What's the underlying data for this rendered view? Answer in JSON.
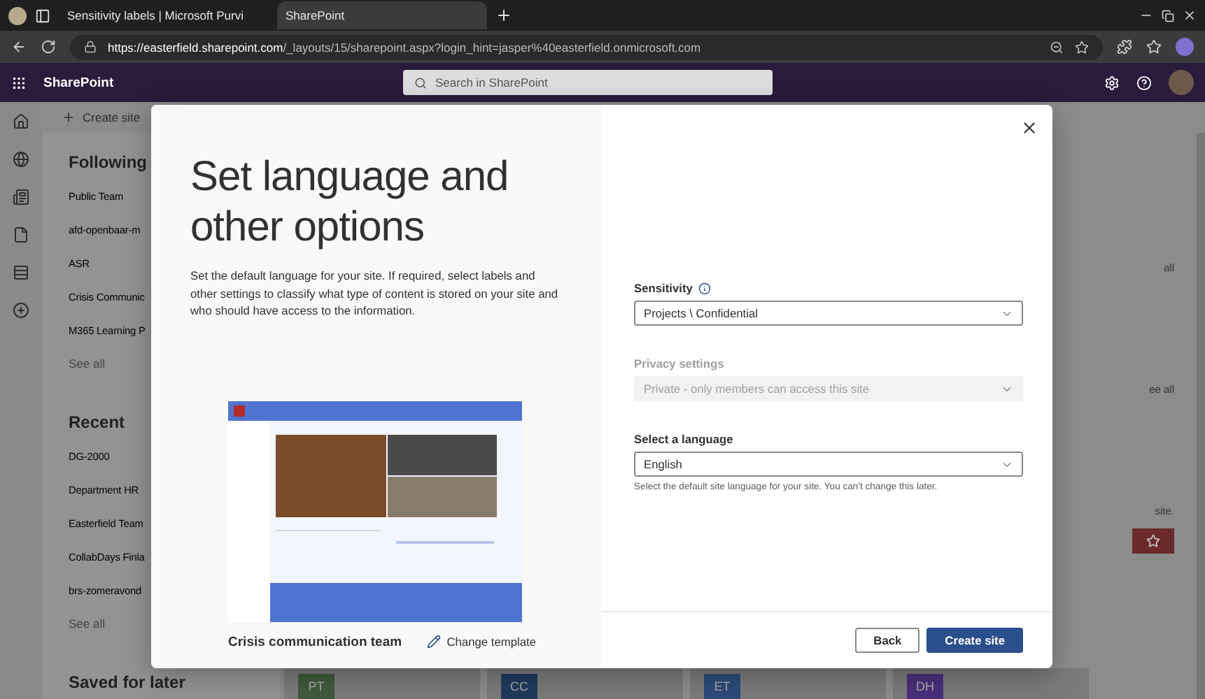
{
  "browser": {
    "tabs": [
      {
        "label": "Sensitivity labels | Microsoft Purvi",
        "selected": false
      },
      {
        "label": "SharePoint",
        "selected": true
      }
    ],
    "url_host": "https://easterfield.sharepoint.com",
    "url_path": "/_layouts/15/sharepoint.aspx?login_hint=jasper%40easterfield.onmicrosoft.com"
  },
  "app_bar": {
    "title": "SharePoint",
    "search": {
      "placeholder": "Search in SharePoint"
    }
  },
  "command_bar": {
    "create_label": "Create site"
  },
  "sidebar": {
    "sections": [
      {
        "title": "Following",
        "items": [
          "Public Team",
          "afd-openbaar-m",
          "ASR",
          "Crisis Communic",
          "M365 Learning P"
        ],
        "see_all": "See all"
      },
      {
        "title": "Recent",
        "items": [
          "DG-2000",
          "Department HR",
          "Easterfield Team",
          "CollabDays Finla",
          "brs-zomeravond"
        ],
        "see_all": "See all"
      },
      {
        "title": "Saved for later"
      }
    ]
  },
  "background": {
    "fragments": [
      "all",
      "ee all",
      "site."
    ],
    "tiles": [
      {
        "initials": "PT",
        "color": "#3f5a3a"
      },
      {
        "initials": "CC",
        "color": "#1e3a5c"
      },
      {
        "initials": "ET",
        "color": "#2c4a7a"
      },
      {
        "initials": "DH",
        "color": "#4a2f7a"
      }
    ]
  },
  "dialog": {
    "title": "Set language and other options",
    "description": "Set the default language for your site. If required, select labels and other settings to classify what type of content is stored on your site and who should have access to the information.",
    "template_name": "Crisis communication team",
    "change_template": "Change template",
    "fields": [
      {
        "label": "Sensitivity",
        "value": "Projects \\ Confidential",
        "info": true,
        "disabled": false
      },
      {
        "label": "Privacy settings",
        "value": "Private - only members can access this site",
        "info": false,
        "disabled": true
      },
      {
        "label": "Select a language",
        "value": "English",
        "info": false,
        "disabled": false,
        "helper": "Select the default site language for your site. You can't change this later."
      }
    ],
    "buttons": [
      {
        "label": "Back",
        "kind": "secondary"
      },
      {
        "label": "Create site",
        "kind": "primary"
      }
    ]
  }
}
